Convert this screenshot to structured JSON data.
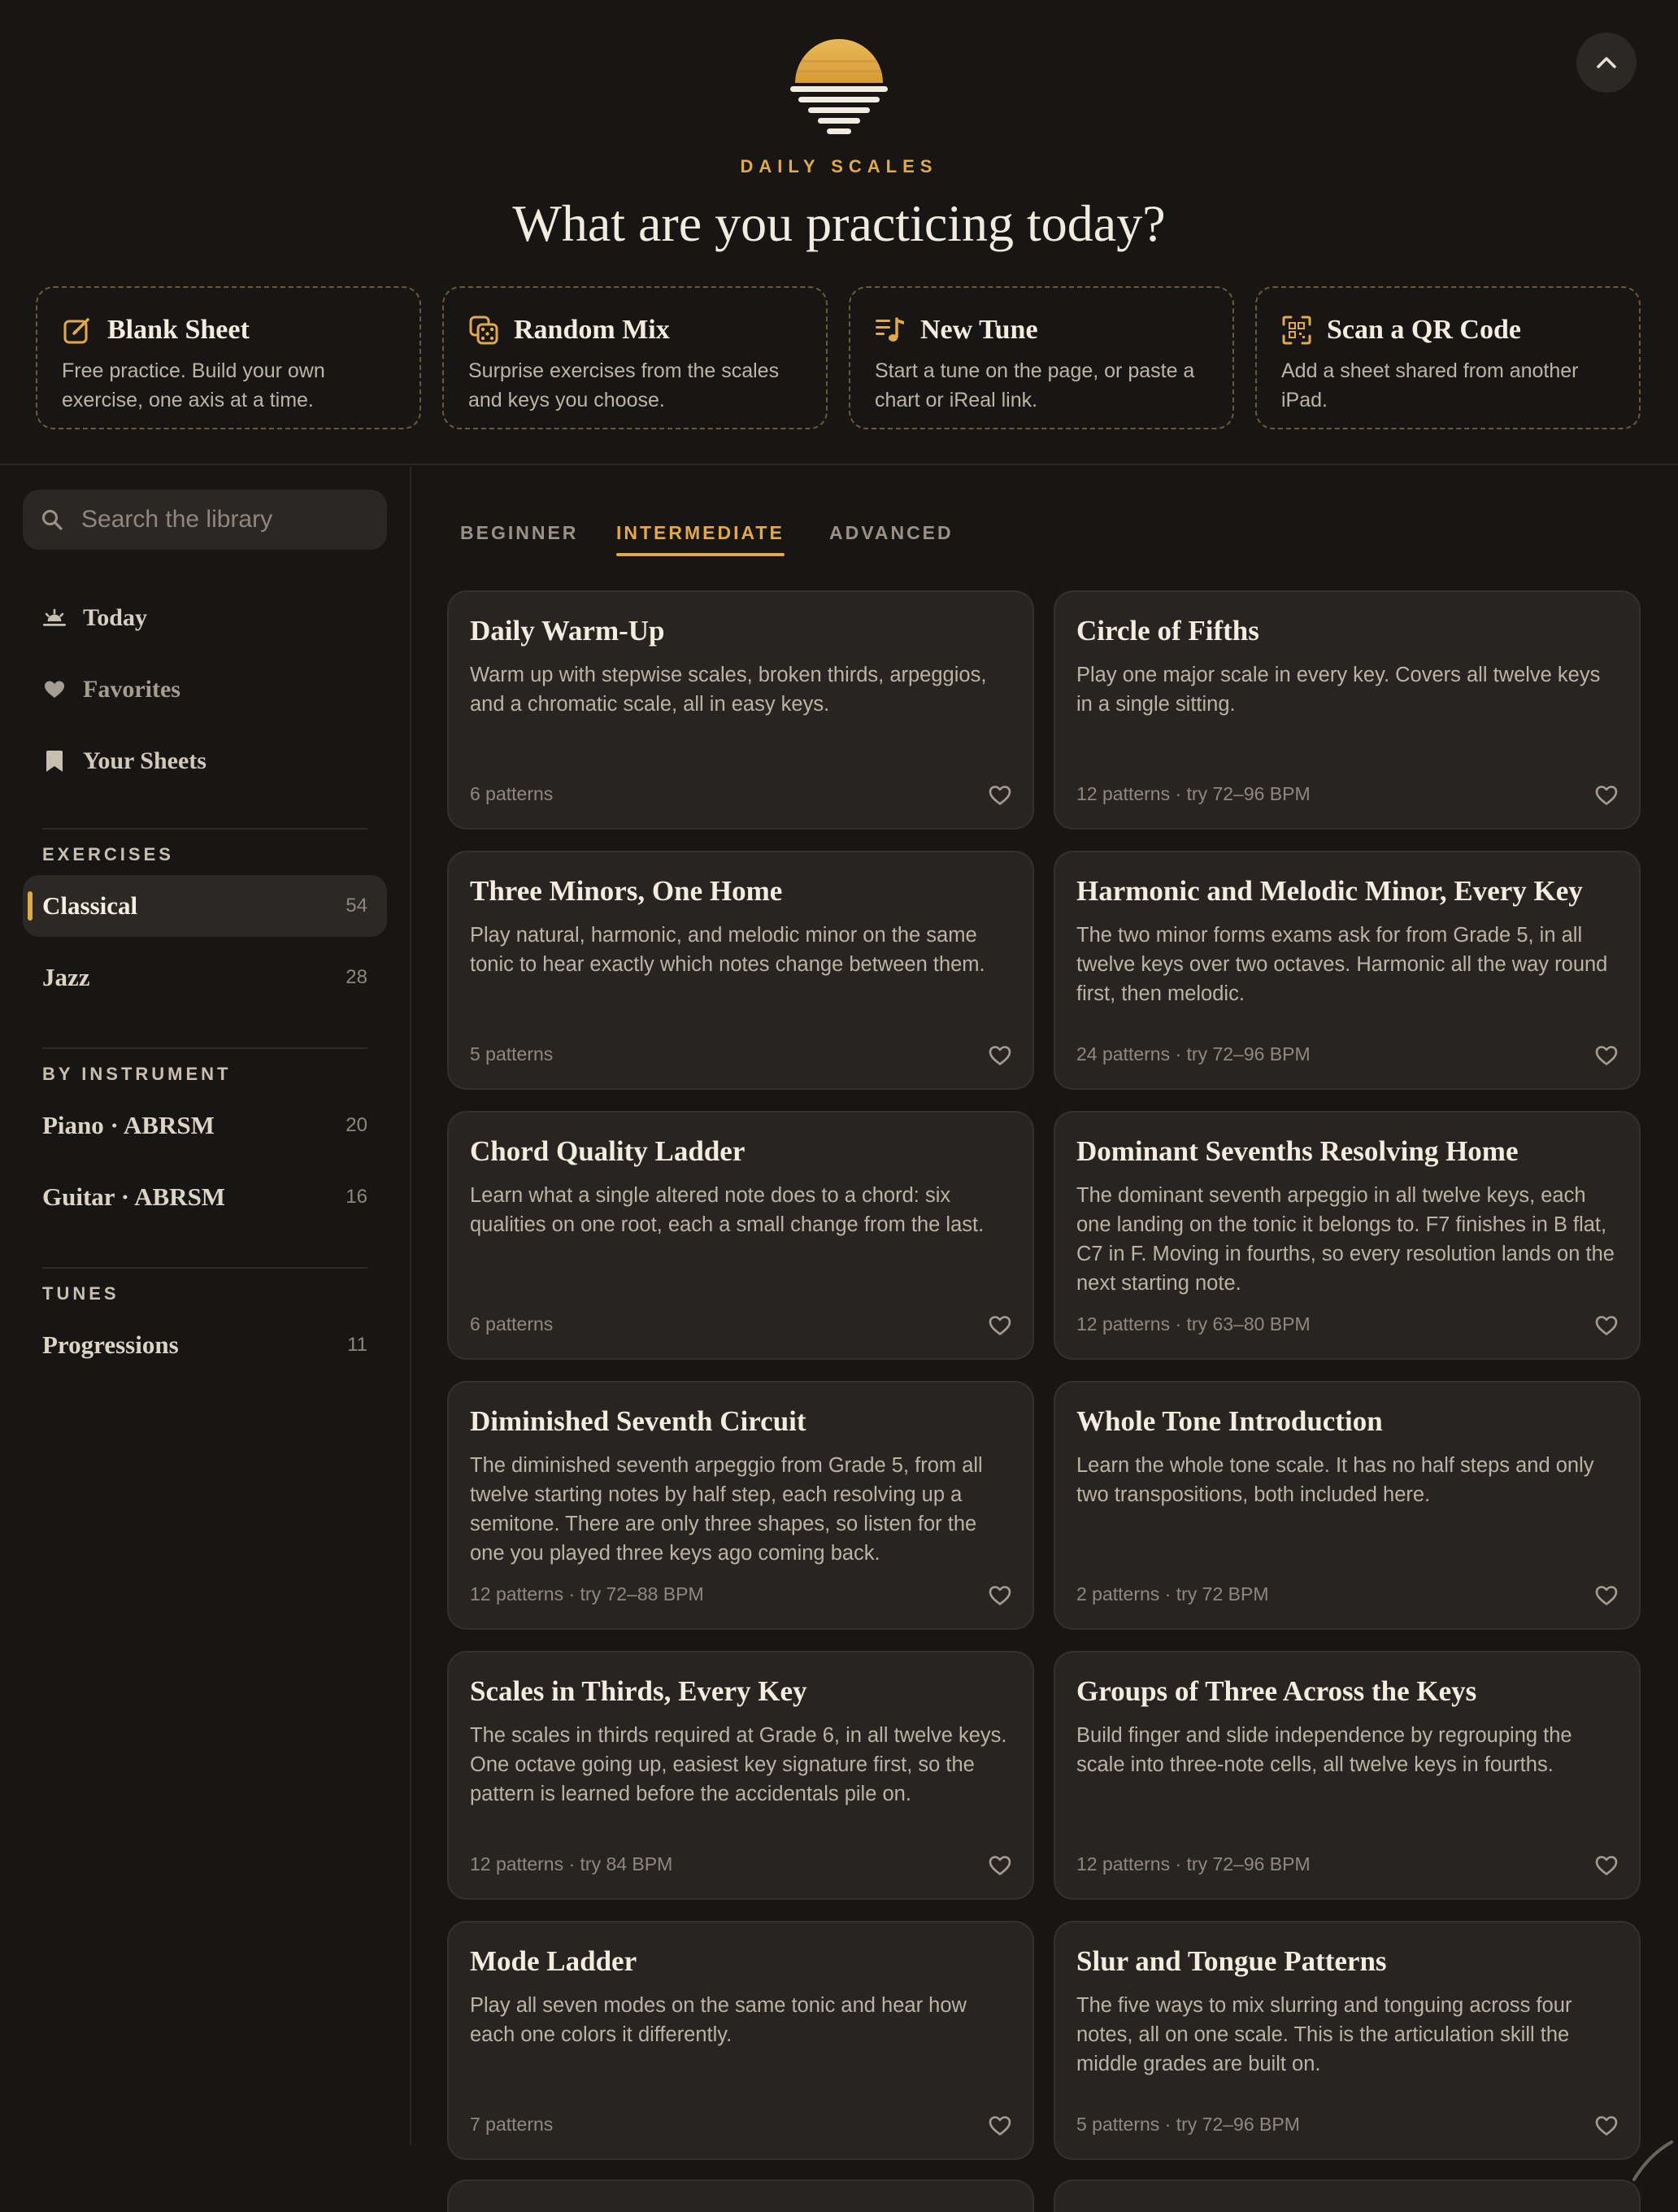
{
  "header": {
    "brand": "DAILY SCALES",
    "headline": "What are you practicing today?",
    "quick_actions": [
      {
        "title": "Blank Sheet",
        "desc": "Free practice. Build your own exercise, one axis at a time.",
        "icon": "edit-icon"
      },
      {
        "title": "Random Mix",
        "desc": "Surprise exercises from the scales and keys you choose.",
        "icon": "dice-icon"
      },
      {
        "title": "New Tune",
        "desc": "Start a tune on the page, or paste a chart or iReal link.",
        "icon": "music-list-icon"
      },
      {
        "title": "Scan a QR Code",
        "desc": "Add a sheet shared from another iPad.",
        "icon": "qr-code-icon"
      }
    ]
  },
  "sidebar": {
    "search_placeholder": "Search the library",
    "nav": [
      {
        "label": "Today",
        "icon": "sunrise-icon"
      },
      {
        "label": "Favorites",
        "icon": "heart-icon"
      },
      {
        "label": "Your Sheets",
        "icon": "bookmark-icon"
      }
    ],
    "sections": [
      {
        "label": "EXERCISES",
        "items": [
          {
            "name": "Classical",
            "count": "54",
            "active": true
          },
          {
            "name": "Jazz",
            "count": "28",
            "active": false
          }
        ]
      },
      {
        "label": "BY INSTRUMENT",
        "items": [
          {
            "name": "Piano · ABRSM",
            "count": "20",
            "active": false
          },
          {
            "name": "Guitar · ABRSM",
            "count": "16",
            "active": false
          }
        ]
      },
      {
        "label": "TUNES",
        "items": [
          {
            "name": "Progressions",
            "count": "11",
            "active": false
          }
        ]
      }
    ]
  },
  "tabs": [
    {
      "label": "BEGINNER",
      "active": false
    },
    {
      "label": "INTERMEDIATE",
      "active": true
    },
    {
      "label": "ADVANCED",
      "active": false
    }
  ],
  "cards": [
    {
      "title": "Daily Warm-Up",
      "desc": "Warm up with stepwise scales, broken thirds, arpeggios, and a chromatic scale, all in easy keys.",
      "meta": "6 patterns"
    },
    {
      "title": "Circle of Fifths",
      "desc": "Play one major scale in every key. Covers all twelve keys in a single sitting.",
      "meta": "12 patterns · try 72–96 BPM"
    },
    {
      "title": "Three Minors, One Home",
      "desc": "Play natural, harmonic, and melodic minor on the same tonic to hear exactly which notes change between them.",
      "meta": "5 patterns"
    },
    {
      "title": "Harmonic and Melodic Minor, Every Key",
      "desc": "The two minor forms exams ask for from Grade 5, in all twelve keys over two octaves. Harmonic all the way round first, then melodic.",
      "meta": "24 patterns · try 72–96 BPM"
    },
    {
      "title": "Chord Quality Ladder",
      "desc": "Learn what a single altered note does to a chord: six qualities on one root, each a small change from the last.",
      "meta": "6 patterns"
    },
    {
      "title": "Dominant Sevenths Resolving Home",
      "desc": "The dominant seventh arpeggio in all twelve keys, each one landing on the tonic it belongs to. F7 finishes in B flat, C7 in F. Moving in fourths, so every resolution lands on the next starting note.",
      "meta": "12 patterns · try 63–80 BPM"
    },
    {
      "title": "Diminished Seventh Circuit",
      "desc": "The diminished seventh arpeggio from Grade 5, from all twelve starting notes by half step, each resolving up a semitone. There are only three shapes, so listen for the one you played three keys ago coming back.",
      "meta": "12 patterns · try 72–88 BPM"
    },
    {
      "title": "Whole Tone Introduction",
      "desc": "Learn the whole tone scale. It has no half steps and only two transpositions, both included here.",
      "meta": "2 patterns · try 72 BPM"
    },
    {
      "title": "Scales in Thirds, Every Key",
      "desc": "The scales in thirds required at Grade 6, in all twelve keys. One octave going up, easiest key signature first, so the pattern is learned before the accidentals pile on.",
      "meta": "12 patterns · try 84 BPM"
    },
    {
      "title": "Groups of Three Across the Keys",
      "desc": "Build finger and slide independence by regrouping the scale into three-note cells, all twelve keys in fourths.",
      "meta": "12 patterns · try 72–96 BPM"
    },
    {
      "title": "Mode Ladder",
      "desc": "Play all seven modes on the same tonic and hear how each one colors it differently.",
      "meta": "7 patterns"
    },
    {
      "title": "Slur and Tongue Patterns",
      "desc": "The five ways to mix slurring and tonguing across four notes, all on one scale. This is the articulation skill the middle grades are built on.",
      "meta": "5 patterns · try 72–96 BPM"
    }
  ],
  "colors": {
    "accent": "#e2a948",
    "background": "#181615",
    "card": "#272422"
  }
}
